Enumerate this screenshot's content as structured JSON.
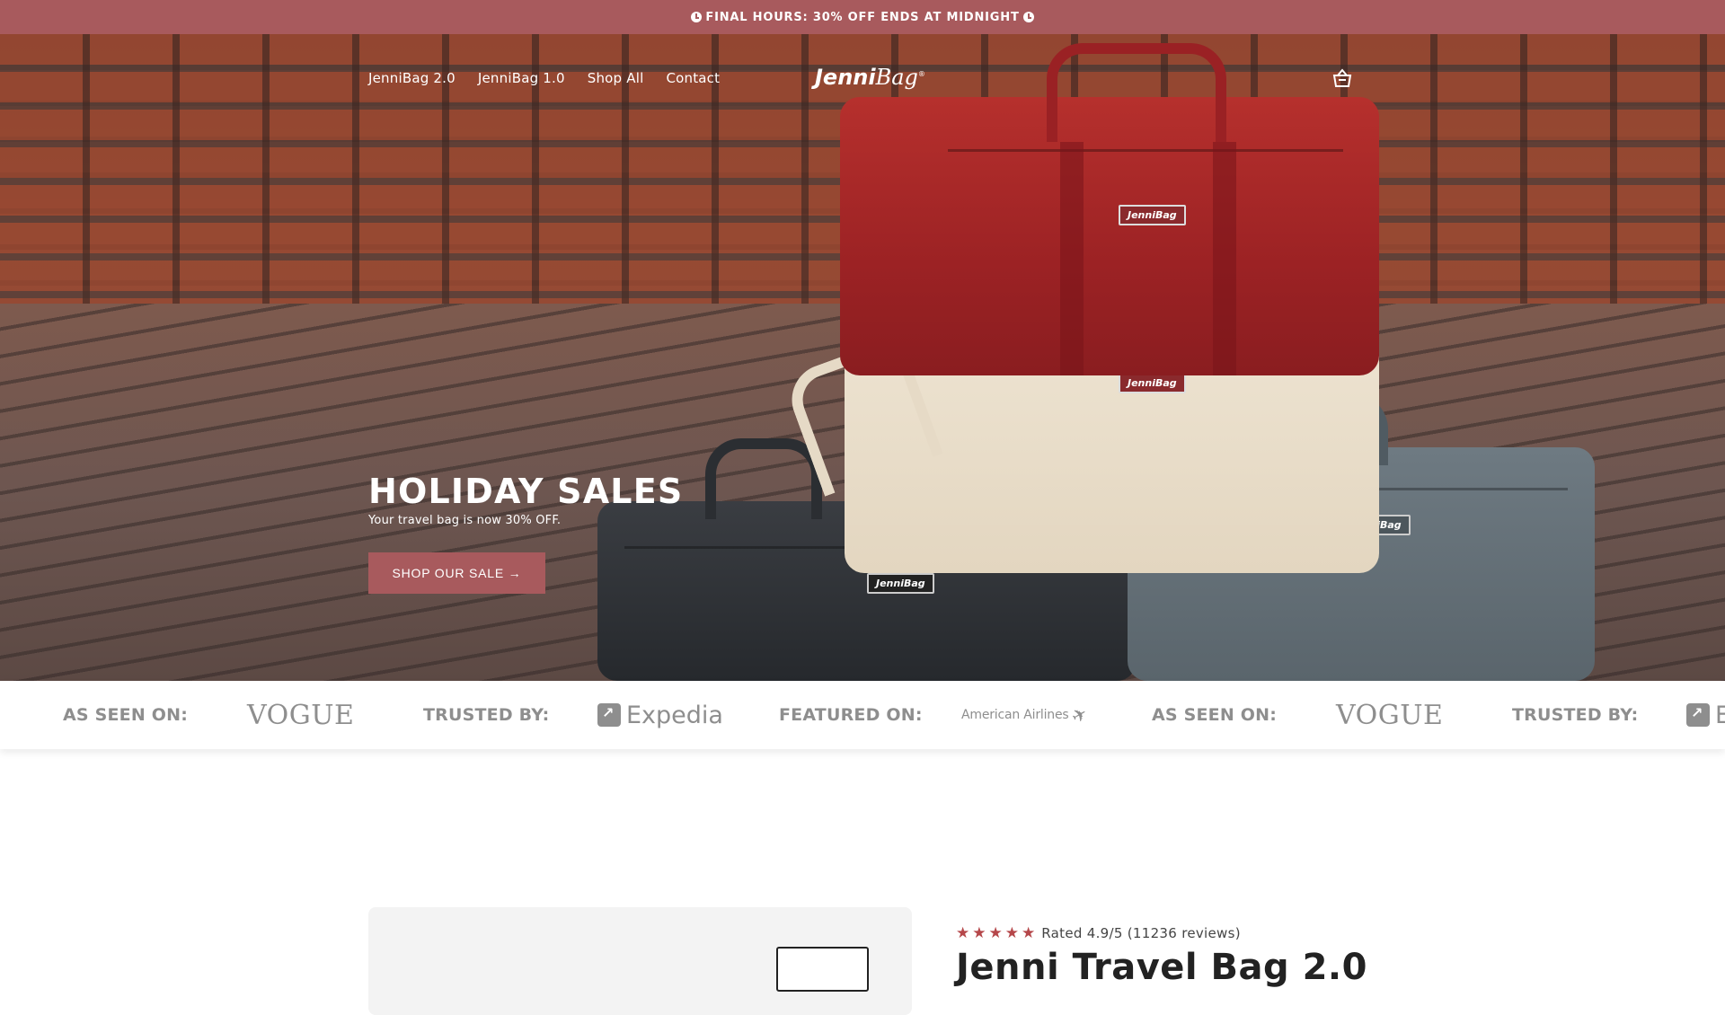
{
  "announcement": {
    "icon": "clock-icon",
    "text": "FINAL HOURS: 30% OFF ENDS AT MIDNIGHT"
  },
  "nav": {
    "links": [
      "JenniBag 2.0",
      "JenniBag 1.0",
      "Shop All",
      "Contact"
    ],
    "logo_bold": "Jenni",
    "logo_italic": "Bag",
    "logo_mark": "®",
    "cart_icon": "basket-icon"
  },
  "hero": {
    "title": "HOLIDAY SALES",
    "subtitle": "Your travel bag is now 30% OFF.",
    "cta_label": "SHOP OUR SALE →",
    "bag_tag": "JenniBag"
  },
  "press_strip": {
    "items": [
      {
        "type": "label",
        "text": "AS SEEN ON:"
      },
      {
        "type": "logo",
        "text": "VOGUE"
      },
      {
        "type": "label",
        "text": "TRUSTED BY:"
      },
      {
        "type": "logo",
        "text": "Expedia"
      },
      {
        "type": "label",
        "text": "FEATURED ON:"
      },
      {
        "type": "logo",
        "text": "American Airlines"
      },
      {
        "type": "label",
        "text": "AS SEEN ON:"
      },
      {
        "type": "logo",
        "text": "VOGUE"
      },
      {
        "type": "label",
        "text": "TRUSTED BY:"
      },
      {
        "type": "logo",
        "text": "E"
      }
    ]
  },
  "product": {
    "rating_stars": 5,
    "rating_text": "Rated 4.9/5 (11236 reviews)",
    "title": "Jenni Travel Bag 2.0"
  },
  "colors": {
    "accent": "#a85a5d",
    "star": "#b5474a",
    "strip_text": "#8e8e8e"
  }
}
